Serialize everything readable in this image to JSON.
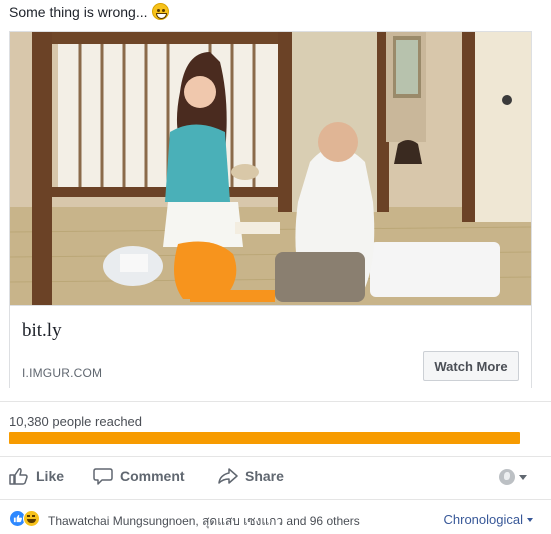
{
  "post": {
    "caption": "Some thing is wrong..."
  },
  "link_card": {
    "image_alt": "Shared link preview photo",
    "title": "bit.ly",
    "domain": "I.IMGUR.COM",
    "cta_label": "Watch More"
  },
  "reach": {
    "label": "10,380 people reached",
    "fraction": 1.0,
    "bar_color": "#f79b00"
  },
  "actions": {
    "like": "Like",
    "comment": "Comment",
    "share": "Share"
  },
  "reactions": {
    "names": "Thawatchai Mungsungnoen, สุดแสบ เซงแกว and 96 others",
    "order_label": "Chronological"
  },
  "colors": {
    "accent": "#4267b2",
    "link": "#385898",
    "like_blue": "#2d88ff"
  }
}
